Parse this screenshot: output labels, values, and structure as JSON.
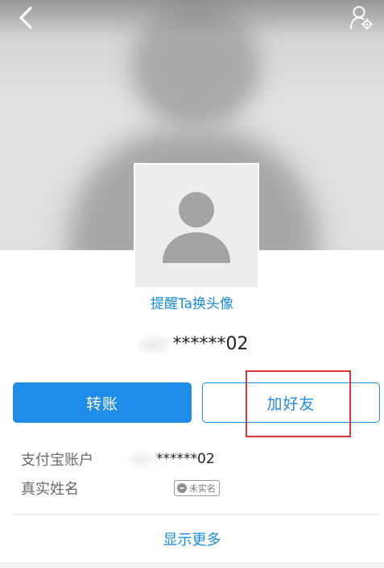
{
  "header": {
    "back_icon": "chevron-left-icon",
    "settings_icon": "person-settings-icon"
  },
  "profile": {
    "remind_link": "提醒Ta换头像",
    "account_masked": "******02"
  },
  "actions": {
    "transfer_label": "转账",
    "add_friend_label": "加好友"
  },
  "info": {
    "account_label": "支付宝账户",
    "account_value": "******02",
    "name_label": "真实姓名",
    "name_badge": "未实名"
  },
  "footer": {
    "show_more": "显示更多"
  },
  "colors": {
    "accent": "#1e8ce8",
    "highlight": "#e03434"
  }
}
